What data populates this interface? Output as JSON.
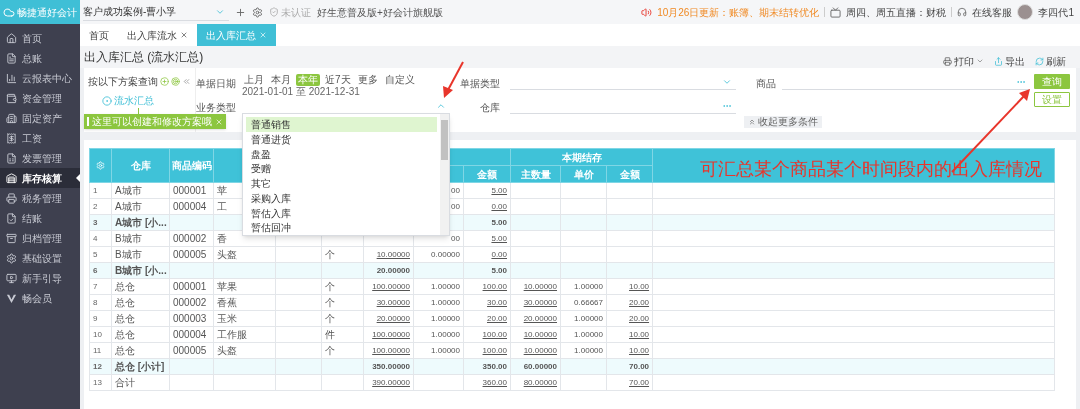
{
  "app": {
    "name": "畅捷通好会计"
  },
  "sidebar": {
    "items": [
      {
        "label": "首页",
        "selected": false
      },
      {
        "label": "总账",
        "selected": false
      },
      {
        "label": "云报表中心",
        "selected": false
      },
      {
        "label": "资金管理",
        "selected": false
      },
      {
        "label": "固定资产",
        "selected": false
      },
      {
        "label": "工资",
        "selected": false
      },
      {
        "label": "发票管理",
        "selected": false
      },
      {
        "label": "库存核算",
        "selected": true
      },
      {
        "label": "税务管理",
        "selected": false
      },
      {
        "label": "结账",
        "selected": false
      },
      {
        "label": "归档管理",
        "selected": false
      },
      {
        "label": "基础设置",
        "selected": false
      },
      {
        "label": "新手引导",
        "selected": false
      },
      {
        "label": "畅会员",
        "selected": false
      }
    ]
  },
  "topbar": {
    "company": "客户成功案例-曹小孚",
    "cert_status": "未认证",
    "edition": "好生意普及版+好会计旗舰版",
    "notice": "10月26日更新：账簿、期末结转优化",
    "live": "周四、周五直播：财税",
    "support": "在线客服",
    "user": "李四代1"
  },
  "tabs": [
    {
      "label": "首页",
      "closable": false,
      "selected": false
    },
    {
      "label": "出入库流水",
      "closable": true,
      "selected": false
    },
    {
      "label": "出入库汇总",
      "closable": true,
      "selected": true
    }
  ],
  "page": {
    "title": "出入库汇总 (流水汇总)",
    "actions": [
      {
        "kind": "print",
        "label": "打印"
      },
      {
        "kind": "export",
        "label": "导出"
      },
      {
        "kind": "refresh",
        "label": "刷新"
      }
    ]
  },
  "scheme_panel": {
    "label": "按以下方案查询",
    "node": "流水汇总",
    "tip": "这里可以创建和修改方案哦"
  },
  "filters": {
    "date": {
      "label": "单据日期",
      "presets": [
        {
          "label": "上月",
          "selected": false
        },
        {
          "label": "本月",
          "selected": false
        },
        {
          "label": "本年",
          "selected": true
        },
        {
          "label": "近7天",
          "selected": false
        },
        {
          "label": "更多",
          "selected": false
        },
        {
          "label": "自定义",
          "selected": false
        }
      ],
      "range": "2021-01-01 至 2021-12-31"
    },
    "fields": [
      {
        "label": "单据类型",
        "kind": "select",
        "expanded": false
      },
      {
        "label": "商品",
        "kind": "lookup"
      },
      {
        "label": "业务类型",
        "kind": "select",
        "expanded": true
      },
      {
        "label": "仓库",
        "kind": "lookup"
      }
    ],
    "buttons": [
      "查询",
      "设置"
    ],
    "collapse": "收起更多条件"
  },
  "dropdown": {
    "options": [
      {
        "label": "普通销售",
        "selected": true
      },
      {
        "label": "普通进货",
        "selected": false
      },
      {
        "label": "盘盈",
        "selected": false
      },
      {
        "label": "受赠",
        "selected": false
      },
      {
        "label": "其它",
        "selected": false
      },
      {
        "label": "采购入库",
        "selected": false
      },
      {
        "label": "暂估入库",
        "selected": false
      },
      {
        "label": "暂估回冲",
        "selected": false
      }
    ]
  },
  "table": {
    "columns": [
      "仓库",
      "商品编码",
      null,
      null,
      null,
      null,
      null,
      "金额",
      "主数量",
      "单价",
      "金额"
    ],
    "group_header": "本期结存",
    "rows": [
      {
        "no": "1",
        "kind": "item",
        "cells": [
          "A城市",
          "000001",
          "苹",
          null,
          null,
          null,
          "00",
          "5.00",
          null,
          null,
          null
        ]
      },
      {
        "no": "2",
        "kind": "item",
        "cells": [
          "A城市",
          "000004",
          "工",
          null,
          null,
          null,
          "00",
          "0.00",
          null,
          null,
          null
        ]
      },
      {
        "no": "3",
        "kind": "subtotal",
        "cells": [
          "A城市 [小...",
          null,
          null,
          null,
          null,
          null,
          null,
          "5.00",
          null,
          null,
          null
        ]
      },
      {
        "no": "4",
        "kind": "item",
        "cells": [
          "B城市",
          "000002",
          "香",
          null,
          null,
          null,
          "00",
          "5.00",
          null,
          null,
          null
        ]
      },
      {
        "no": "5",
        "kind": "item",
        "cells": [
          "B城市",
          "000005",
          "头盔",
          null,
          "个",
          "10.00000",
          "0.00000",
          "0.00",
          null,
          null,
          null
        ]
      },
      {
        "no": "6",
        "kind": "subtotal",
        "cells": [
          "B城市 [小...",
          null,
          null,
          null,
          null,
          "20.00000",
          null,
          "5.00",
          null,
          null,
          null
        ]
      },
      {
        "no": "7",
        "kind": "item",
        "cells": [
          "总仓",
          "000001",
          "苹果",
          null,
          "个",
          "100.00000",
          "1.00000",
          "100.00",
          "10.00000",
          "1.00000",
          "10.00"
        ]
      },
      {
        "no": "8",
        "kind": "item",
        "cells": [
          "总仓",
          "000002",
          "香蕉",
          null,
          "个",
          "30.00000",
          "1.00000",
          "30.00",
          "30.00000",
          "0.66667",
          "20.00"
        ]
      },
      {
        "no": "9",
        "kind": "item",
        "cells": [
          "总仓",
          "000003",
          "玉米",
          null,
          "个",
          "20.00000",
          "1.00000",
          "20.00",
          "20.00000",
          "1.00000",
          "20.00"
        ]
      },
      {
        "no": "10",
        "kind": "item",
        "cells": [
          "总仓",
          "000004",
          "工作服",
          null,
          "件",
          "100.00000",
          "1.00000",
          "100.00",
          "10.00000",
          "1.00000",
          "10.00"
        ]
      },
      {
        "no": "11",
        "kind": "item",
        "cells": [
          "总仓",
          "000005",
          "头盔",
          null,
          "个",
          "100.00000",
          "1.00000",
          "100.00",
          "10.00000",
          "1.00000",
          "10.00"
        ]
      },
      {
        "no": "12",
        "kind": "subtotal",
        "cells": [
          "总仓 [小计]",
          null,
          null,
          null,
          null,
          "350.00000",
          null,
          "350.00",
          "60.00000",
          null,
          "70.00"
        ]
      },
      {
        "no": "13",
        "kind": "total",
        "cells": [
          "合计",
          null,
          null,
          null,
          null,
          "390.00000",
          null,
          "360.00",
          "80.00000",
          null,
          "70.00"
        ]
      }
    ]
  },
  "annotation": "可汇总某个商品某个时间段内的出入库情况"
}
